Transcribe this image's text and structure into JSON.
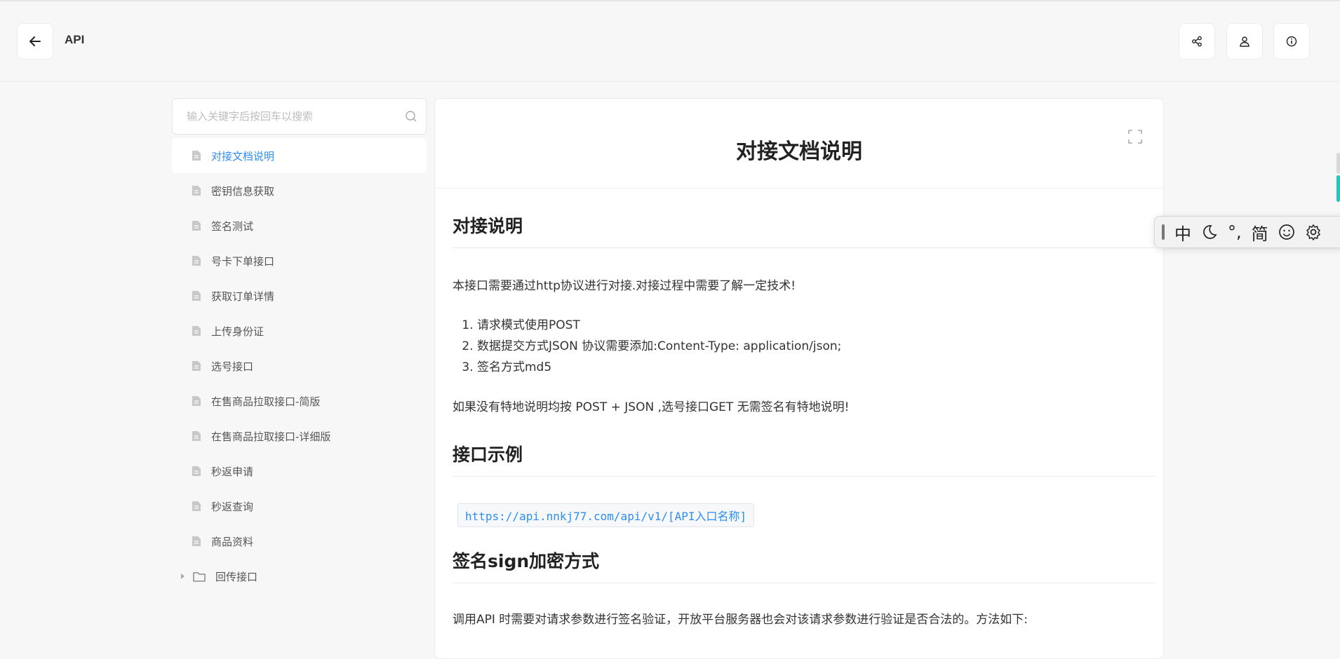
{
  "header": {
    "title": "API"
  },
  "search": {
    "placeholder": "输入关键字后按回车以搜索"
  },
  "sidebar": {
    "items": [
      {
        "label": "对接文档说明"
      },
      {
        "label": "密钥信息获取"
      },
      {
        "label": "签名测试"
      },
      {
        "label": "号卡下单接口"
      },
      {
        "label": "获取订单详情"
      },
      {
        "label": "上传身份证"
      },
      {
        "label": "选号接口"
      },
      {
        "label": "在售商品拉取接口-简版"
      },
      {
        "label": "在售商品拉取接口-详细版"
      },
      {
        "label": "秒返申请"
      },
      {
        "label": "秒返查询"
      },
      {
        "label": "商品资料"
      }
    ],
    "folder": {
      "label": "回传接口"
    }
  },
  "doc": {
    "title": "对接文档说明",
    "section1_title": "对接说明",
    "intro": "本接口需要通过http协议进行对接.对接过程中需要了解一定技术!",
    "steps": [
      "请求模式使用POST",
      "数据提交方式JSON 协议需要添加:Content-Type: application/json;",
      "签名方式md5"
    ],
    "note": "如果没有特地说明均按 POST + JSON ,选号接口GET 无需签名有特地说明!",
    "section2_title": "接口示例",
    "example_url": "https://api.nnkj77.com/api/v1/[API入口名称]",
    "section3_title": "签名sign加密方式",
    "sign_desc": "调用API 时需要对请求参数进行签名验证，开放平台服务器也会对该请求参数进行验证是否合法的。方法如下:"
  },
  "ime": {
    "mode": "中",
    "punct": "°,",
    "script": "简"
  },
  "colors": {
    "accent": "#2f8cf0",
    "background": "#f7f7f7"
  }
}
